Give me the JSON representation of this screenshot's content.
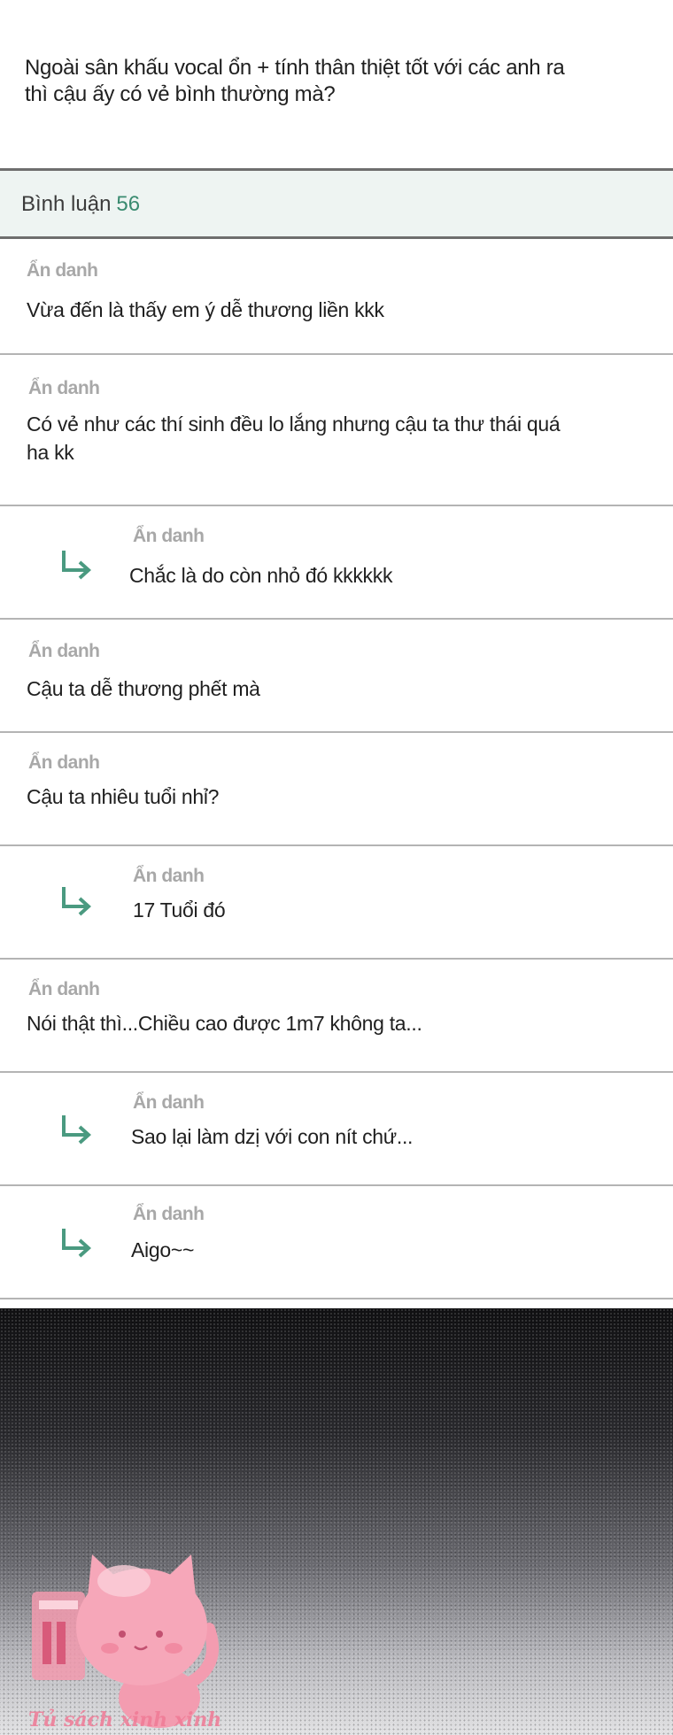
{
  "post": {
    "line1": "Ngoài sân khấu vocal ổn + tính thân thiệt tốt với các anh ra",
    "line2": "thì cậu ấy có vẻ bình thường mà?"
  },
  "comments_header": {
    "label": "Bình luận",
    "count": "56"
  },
  "comments": [
    {
      "author": "Ẩn danh",
      "text": "Vừa đến là thấy em ý dễ thương liền kkk"
    },
    {
      "author": "Ẩn danh",
      "line1": "Có vẻ như các thí sinh đều lo lắng nhưng cậu ta thư thái quá",
      "line2": "ha kk"
    },
    {
      "author": "Ẩn danh",
      "text": "Chắc là do còn nhỏ đó kkkkkk",
      "reply": true
    },
    {
      "author": "Ẩn danh",
      "text": "Cậu ta dễ thương phết mà"
    },
    {
      "author": "Ẩn danh",
      "text": "Cậu ta nhiêu tuổi nhỉ?"
    },
    {
      "author": "Ẩn danh",
      "text": "17 Tuổi đó",
      "reply": true
    },
    {
      "author": "Ẩn danh",
      "text": "Nói thật thì...Chiều cao được 1m7 không ta..."
    },
    {
      "author": "Ẩn danh",
      "text": "Sao lại làm dzị với con nít chứ...",
      "reply": true
    },
    {
      "author": "Ẩn danh",
      "text": "Aigo~~",
      "reply": true
    }
  ],
  "watermark": {
    "text": "Tủ sách xinh xinh"
  },
  "colors": {
    "accent": "#3a8b70",
    "reply_arrow": "#4a9a80",
    "author": "#a8a8a8",
    "header_bg": "#eef4f2"
  },
  "icons": {
    "reply": "reply-arrow-icon",
    "mascot": "cat-mascot-icon"
  }
}
